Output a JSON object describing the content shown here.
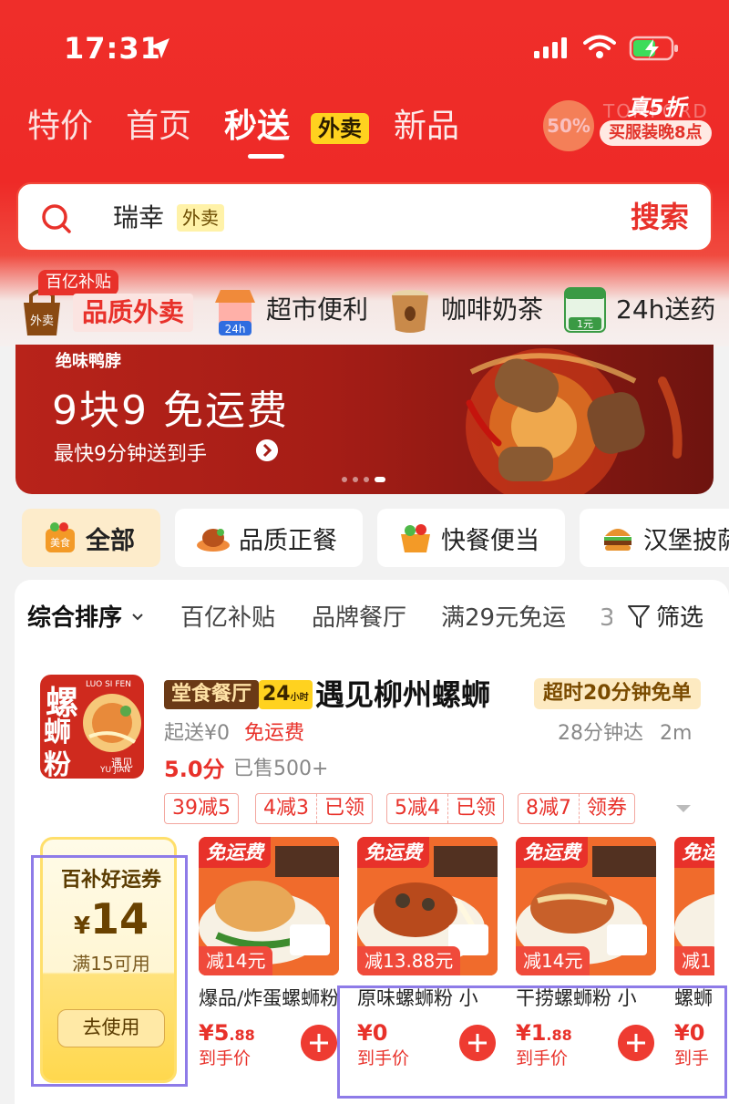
{
  "status_bar": {
    "time": "17:31"
  },
  "top_tabs": [
    {
      "label": "特价"
    },
    {
      "label": "首页"
    },
    {
      "label": "秒送",
      "badge": "外卖",
      "active": true
    },
    {
      "label": "新品"
    }
  ],
  "promo": {
    "title": "真5折",
    "subtitle": "买服装晚8点",
    "percent": "50%",
    "ghost": "TOMFORD"
  },
  "search": {
    "value": "瑞幸",
    "tag": "外卖",
    "button": "搜索"
  },
  "categories": [
    {
      "label": "品质外卖",
      "badge": "百亿补贴",
      "icon_text": "外卖"
    },
    {
      "label": "超市便利",
      "icon_text": "24h"
    },
    {
      "label": "咖啡奶茶"
    },
    {
      "label": "24h送药",
      "icon_text": "1元"
    }
  ],
  "banner": {
    "brand": "绝味鸭脖",
    "title": "9块9 免运费",
    "subtitle": "最快9分钟送到手",
    "page_count": 4,
    "active_page": 4
  },
  "filter_chips": [
    {
      "label": "全部",
      "icon_text": "美食",
      "active": true
    },
    {
      "label": "品质正餐"
    },
    {
      "label": "快餐便当"
    },
    {
      "label": "汉堡披萨"
    }
  ],
  "sort_bar": {
    "items": [
      "综合排序",
      "百亿补贴",
      "品牌餐厅",
      "满29元免运",
      "3"
    ],
    "filter_label": "筛选"
  },
  "shop": {
    "logo": {
      "big": "螺",
      "line2": "蛳",
      "line3": "粉",
      "en": "LUO SI FEN",
      "brand": "遇见",
      "brand_en": "YU JIAN"
    },
    "tags": [
      "堂食餐厅",
      "24"
    ],
    "tag_24_small": "小时",
    "name": "遇见柳州螺蛳",
    "guarantee": "超时20分钟免单",
    "min_order": "起送¥0",
    "delivery_fee": "免运费",
    "eta": "28分钟达",
    "distance": "2m",
    "rating": "5.0分",
    "sold": "已售500+",
    "coupons": [
      {
        "text": "39减5"
      },
      {
        "text": "4减3",
        "action": "已领"
      },
      {
        "text": "5减4",
        "action": "已领"
      },
      {
        "text": "8减7",
        "action": "领券"
      }
    ],
    "lucky_coupon": {
      "title": "百补好运券",
      "currency": "¥",
      "amount": "14",
      "condition": "满15可用",
      "button": "去使用"
    },
    "items": [
      {
        "free": "免运费",
        "save": "减14元",
        "name": "爆品/炸蛋螺蛳粉",
        "price_int": "¥5",
        "price_dec": ".88",
        "unit": "到手价"
      },
      {
        "free": "免运费",
        "save": "减13.88元",
        "name": "原味螺蛳粉 小",
        "price_int": "¥0",
        "price_dec": "",
        "unit": "到手价"
      },
      {
        "free": "免运费",
        "save": "减14元",
        "name": "干捞螺蛳粉 小",
        "price_int": "¥1",
        "price_dec": ".88",
        "unit": "到手价"
      },
      {
        "free": "免运",
        "save": "减1",
        "name": "螺蛳",
        "price_int": "¥0",
        "price_dec": "",
        "unit": "到手"
      }
    ]
  },
  "colors": {
    "brand_red": "#ee2a27",
    "accent_yellow": "#ffd21f",
    "highlight_box": "#8e7be8"
  }
}
